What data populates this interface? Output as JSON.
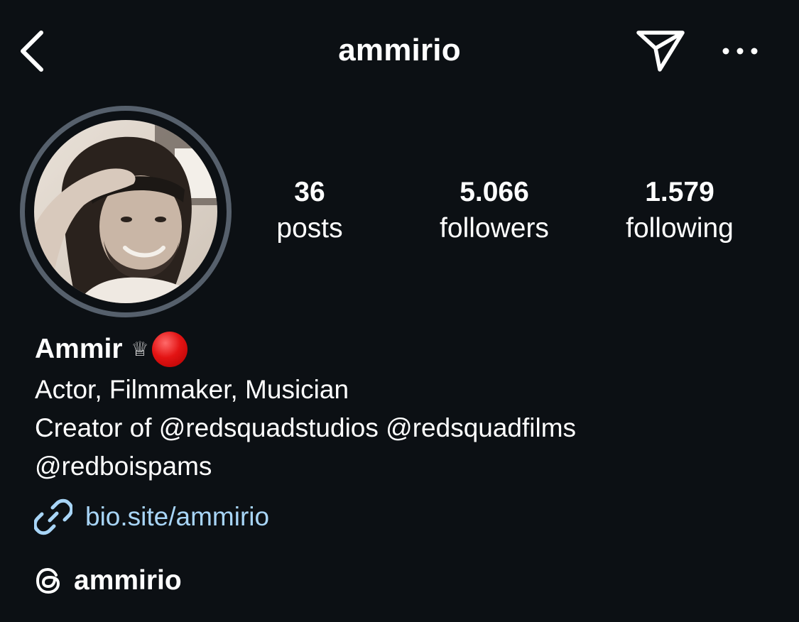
{
  "header": {
    "username": "ammirio",
    "back_icon": "chevron-left-icon",
    "send_icon": "paper-plane-icon",
    "more_icon": "more-horizontal-icon"
  },
  "profile": {
    "avatar_icon": "profile-photo"
  },
  "stats": {
    "posts": {
      "value": "36",
      "label": "posts"
    },
    "followers": {
      "value": "5.066",
      "label": "followers"
    },
    "following": {
      "value": "1.579",
      "label": "following"
    }
  },
  "bio": {
    "name": "Ammir",
    "name_emoji_crown": "♕",
    "name_emoji_circle": "red-circle",
    "line1": "Actor, Filmmaker, Musician",
    "line2": "Creator of @redsquadstudios @redsquadfilms",
    "line3": "@redboispams",
    "link": "bio.site/ammirio",
    "threads_handle": "ammirio"
  },
  "colors": {
    "background": "#0c1014",
    "link": "#a8d5f7",
    "avatar_ring": "#56606c",
    "red_emoji": "#e31414"
  }
}
